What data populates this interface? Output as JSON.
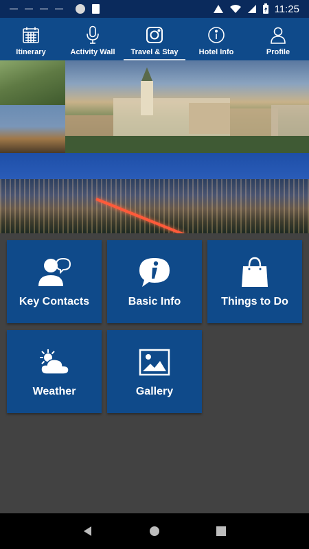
{
  "status_bar": {
    "time": "11:25",
    "icons": [
      "wifi-icon",
      "signal-icon",
      "battery-charging-icon",
      "sd-card-icon"
    ]
  },
  "nav": {
    "items": [
      {
        "label": "Itinerary",
        "icon": "calendar-icon"
      },
      {
        "label": "Activity Wall",
        "icon": "microphone-icon"
      },
      {
        "label": "Travel & Stay",
        "icon": "camera-icon",
        "active": true
      },
      {
        "label": "Hotel Info",
        "icon": "info-icon"
      },
      {
        "label": "Profile",
        "icon": "person-icon"
      }
    ]
  },
  "tiles": [
    {
      "label": "Key Contacts",
      "icon": "contact-person-icon"
    },
    {
      "label": "Basic Info",
      "icon": "info-bubble-icon"
    },
    {
      "label": "Things to Do",
      "icon": "shopping-bag-icon"
    },
    {
      "label": "Weather",
      "icon": "weather-sun-cloud-icon"
    },
    {
      "label": "Gallery",
      "icon": "image-gallery-icon"
    }
  ],
  "colors": {
    "status_bar": "#0a2a5c",
    "nav_bg": "#0f4a8a",
    "tile_bg": "#0f4a8a",
    "page_bg": "#424242",
    "system_nav": "#000000"
  }
}
